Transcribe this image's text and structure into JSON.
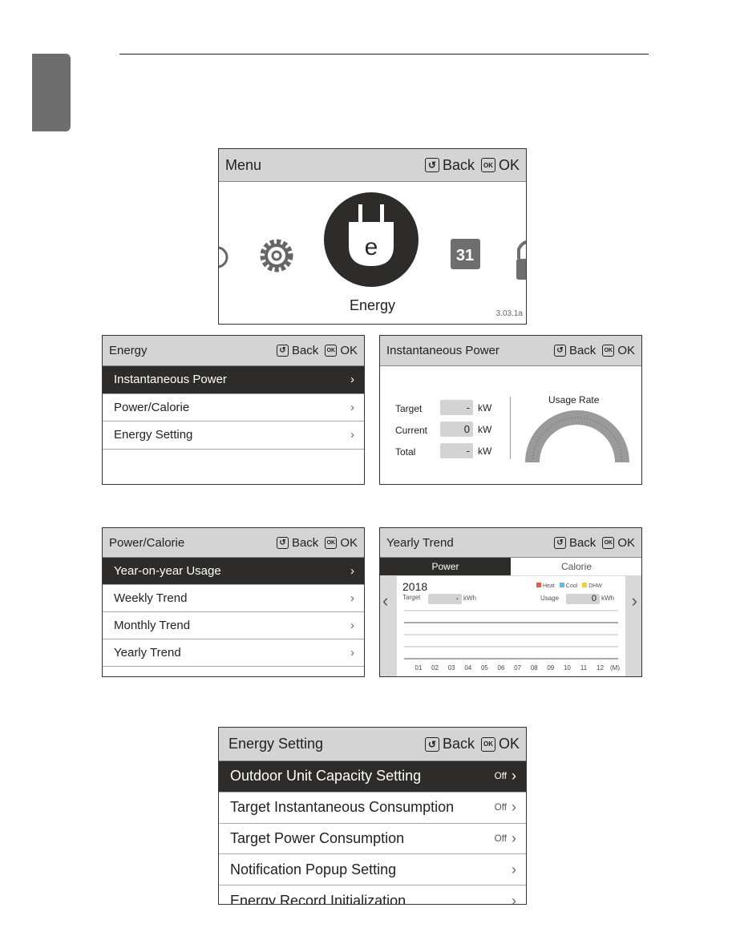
{
  "common": {
    "back": "Back",
    "ok": "OK",
    "back_icon": "back-arrow-icon",
    "ok_icon": "OK",
    "chevron": "›"
  },
  "menu_screen": {
    "title": "Menu",
    "selected_label": "Energy",
    "version": "3.03.1a",
    "icons": [
      "timer-icon",
      "gear-icon",
      "energy-plug-icon",
      "calendar-icon",
      "lock-icon"
    ],
    "calendar_text": "31",
    "plug_text": "e"
  },
  "energy_screen": {
    "title": "Energy",
    "items": [
      {
        "label": "Instantaneous Power",
        "selected": true
      },
      {
        "label": "Power/Calorie"
      },
      {
        "label": "Energy Setting"
      }
    ]
  },
  "instant_screen": {
    "title": "Instantaneous Power",
    "rows": [
      {
        "label": "Target",
        "value": "-",
        "unit": "kW"
      },
      {
        "label": "Current",
        "value": "0",
        "unit": "kW"
      },
      {
        "label": "Total",
        "value": "-",
        "unit": "kW"
      }
    ],
    "gauge_title": "Usage Rate"
  },
  "power_calorie_screen": {
    "title": "Power/Calorie",
    "items": [
      {
        "label": "Year-on-year Usage",
        "selected": true
      },
      {
        "label": "Weekly Trend"
      },
      {
        "label": "Monthly Trend"
      },
      {
        "label": "Yearly Trend"
      }
    ]
  },
  "yearly_screen": {
    "title": "Yearly Trend",
    "tabs": [
      "Power",
      "Calorie"
    ],
    "active_tab": "Power",
    "year": "2018",
    "target_label": "Target",
    "target_value": "-",
    "target_unit": "kWh",
    "usage_label": "Usage",
    "usage_value": "0",
    "usage_unit": "kWh",
    "legend": [
      {
        "name": "Heat",
        "color": "#e8594f"
      },
      {
        "name": "Cool",
        "color": "#6bb7e3"
      },
      {
        "name": "DHW",
        "color": "#f0d040"
      }
    ],
    "months": [
      "01",
      "02",
      "03",
      "04",
      "05",
      "06",
      "07",
      "08",
      "09",
      "10",
      "11",
      "12"
    ],
    "month_unit": "(M)",
    "prev": "‹",
    "next": "›"
  },
  "energy_setting_screen": {
    "title": "Energy Setting",
    "items": [
      {
        "label": "Outdoor Unit Capacity Setting",
        "value": "Off",
        "selected": true
      },
      {
        "label": "Target Instantaneous Consumption",
        "value": "Off"
      },
      {
        "label": "Target Power Consumption",
        "value": "Off"
      },
      {
        "label": "Notification Popup Setting",
        "value": ""
      },
      {
        "label": "Energy Record Initialization",
        "value": ""
      }
    ]
  }
}
